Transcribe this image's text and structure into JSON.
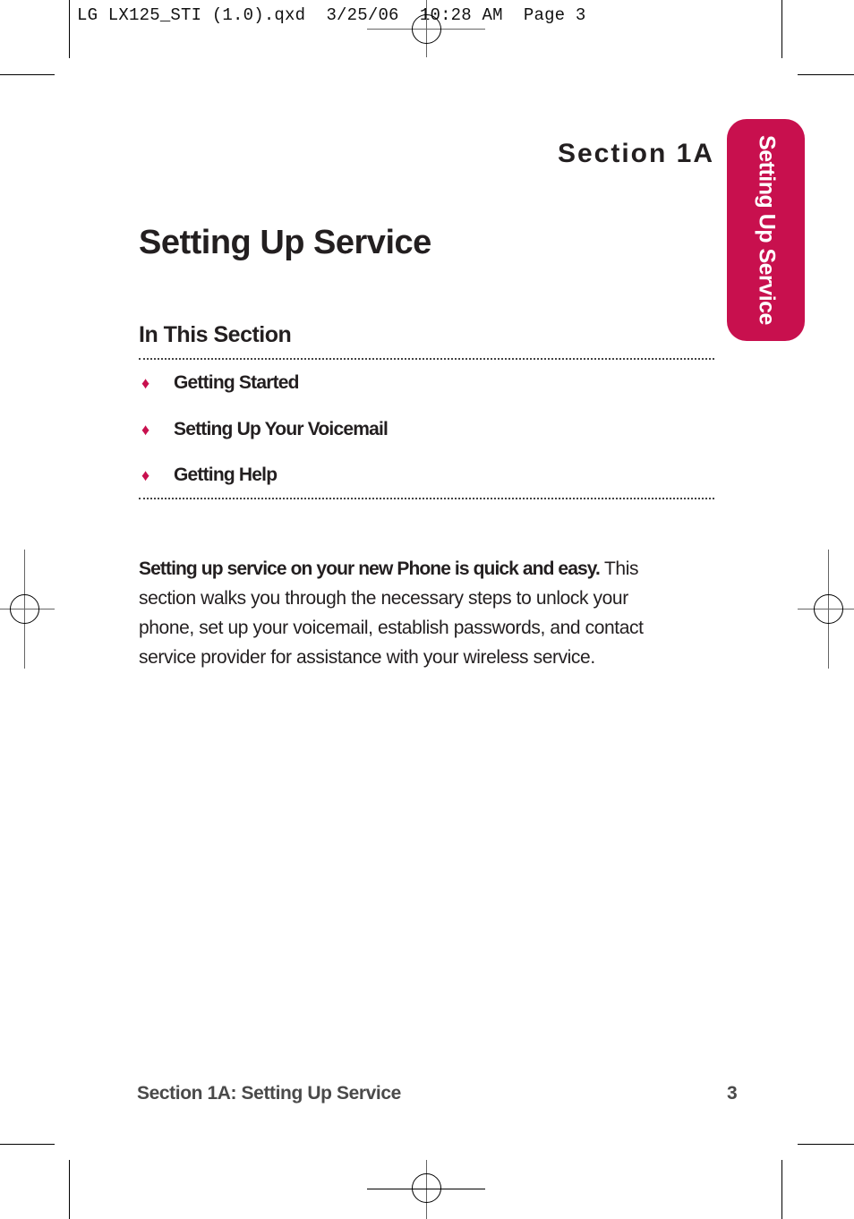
{
  "print_slug": "LG LX125_STI (1.0).qxd  3/25/06  10:28 AM  Page 3",
  "section_label": "Section 1A",
  "side_tab": {
    "label": "Setting Up Service",
    "color": "#c8104e"
  },
  "page_title": "Setting Up Service",
  "in_this_section": {
    "heading": "In This Section",
    "items": [
      {
        "bullet": "♦",
        "label": "Getting Started"
      },
      {
        "bullet": "♦",
        "label": "Setting Up Your Voicemail"
      },
      {
        "bullet": "♦",
        "label": "Getting Help"
      }
    ]
  },
  "intro": {
    "bold_lead": "Setting up service on your new Phone is quick and easy.",
    "text": " This section walks you through the necessary steps to unlock your phone, set up your voicemail, establish passwords, and contact service provider for assistance with your wireless service."
  },
  "footer": {
    "section_title": "Section 1A: Setting Up Service",
    "page_number": "3"
  }
}
